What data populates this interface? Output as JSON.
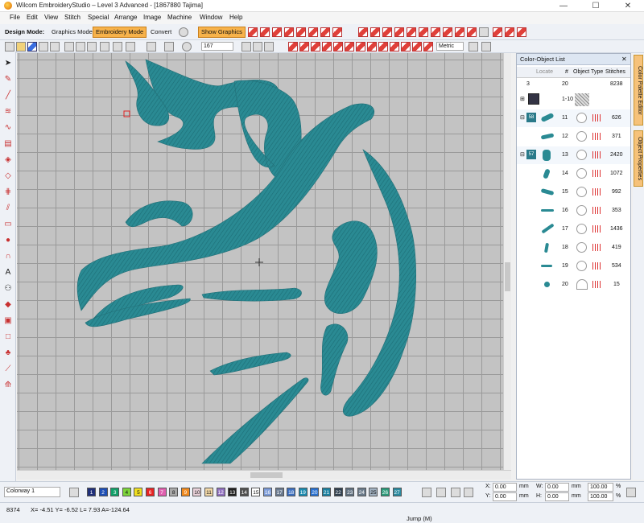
{
  "window": {
    "title": "Wilcom EmbroideryStudio – Level 3 Advanced - [1867880          Tajima]"
  },
  "menu": [
    "File",
    "Edit",
    "View",
    "Stitch",
    "Special",
    "Arrange",
    "Image",
    "Machine",
    "Window",
    "Help"
  ],
  "toolbar": {
    "design_mode_label": "Design Mode:",
    "graphics_mode": "Graphics Mode",
    "embroidery_mode": "Embroidery Mode",
    "convert": "Convert",
    "show_graphics": "Show Graphics",
    "zoom_value": "167",
    "units": "Metric"
  },
  "panel": {
    "title": "Color-Object List",
    "header": {
      "locate": "Locate",
      "hash": "#",
      "object_type": "Object Type",
      "stitches": "Stitches"
    },
    "summary": {
      "colors": "3",
      "objects": "20",
      "stitches": "8238"
    },
    "rows": [
      {
        "num": "1-10",
        "stitches": ""
      },
      {
        "group": "58",
        "num": "11",
        "stitches": "626"
      },
      {
        "num": "12",
        "stitches": "371"
      },
      {
        "group": "57",
        "num": "13",
        "stitches": "2420"
      },
      {
        "num": "14",
        "stitches": "1072"
      },
      {
        "num": "15",
        "stitches": "992"
      },
      {
        "num": "16",
        "stitches": "353"
      },
      {
        "num": "17",
        "stitches": "1436"
      },
      {
        "num": "18",
        "stitches": "419"
      },
      {
        "num": "19",
        "stitches": "534"
      },
      {
        "num": "20",
        "stitches": "15"
      }
    ]
  },
  "sidetabs": [
    "Color Palette Editor",
    "Object Properties"
  ],
  "bottom": {
    "colorway": "Colorway 1",
    "swatches": [
      {
        "n": "1",
        "c": "#20307a"
      },
      {
        "n": "2",
        "c": "#1e4fb5"
      },
      {
        "n": "3",
        "c": "#12a06a"
      },
      {
        "n": "4",
        "c": "#7cd43a"
      },
      {
        "n": "5",
        "c": "#f0e020"
      },
      {
        "n": "6",
        "c": "#e82424"
      },
      {
        "n": "7",
        "c": "#e060b0"
      },
      {
        "n": "8",
        "c": "#a8a8a8"
      },
      {
        "n": "9",
        "c": "#f08a20"
      },
      {
        "n": "10",
        "c": "#e8d0d8"
      },
      {
        "n": "11",
        "c": "#f2d8a8"
      },
      {
        "n": "12",
        "c": "#9070c0"
      },
      {
        "n": "13",
        "c": "#202020"
      },
      {
        "n": "14",
        "c": "#505050"
      },
      {
        "n": "15",
        "c": "#ffffff"
      },
      {
        "n": "16",
        "c": "#7a9ad8"
      },
      {
        "n": "17",
        "c": "#6a7a90"
      },
      {
        "n": "18",
        "c": "#3a6ec0"
      },
      {
        "n": "19",
        "c": "#1a8ab0"
      },
      {
        "n": "20",
        "c": "#2870d0"
      },
      {
        "n": "21",
        "c": "#1a80a0"
      },
      {
        "n": "22",
        "c": "#304050"
      },
      {
        "n": "23",
        "c": "#607080"
      },
      {
        "n": "24",
        "c": "#6a7a8a"
      },
      {
        "n": "25",
        "c": "#a0b0c0"
      },
      {
        "n": "26",
        "c": "#2a9a7a"
      },
      {
        "n": "27",
        "c": "#2a8aa0"
      }
    ],
    "x_label": "X:",
    "x_value": "0.00",
    "y_label": "Y:",
    "y_value": "0.00",
    "w_label": "W:",
    "w_value": "0.00",
    "h_label": "H:",
    "h_value": "0.00",
    "unit": "mm",
    "pct1": "100.00",
    "pct2": "100.00",
    "pct_sign": "%"
  },
  "status": {
    "count": "8374",
    "coords": "X= -4.51 Y= -6.52 L= 7.93 A=-124.64",
    "mode": "Jump (M)"
  },
  "colors": {
    "thread": "#2a8a93",
    "active": "#f7b24a"
  }
}
